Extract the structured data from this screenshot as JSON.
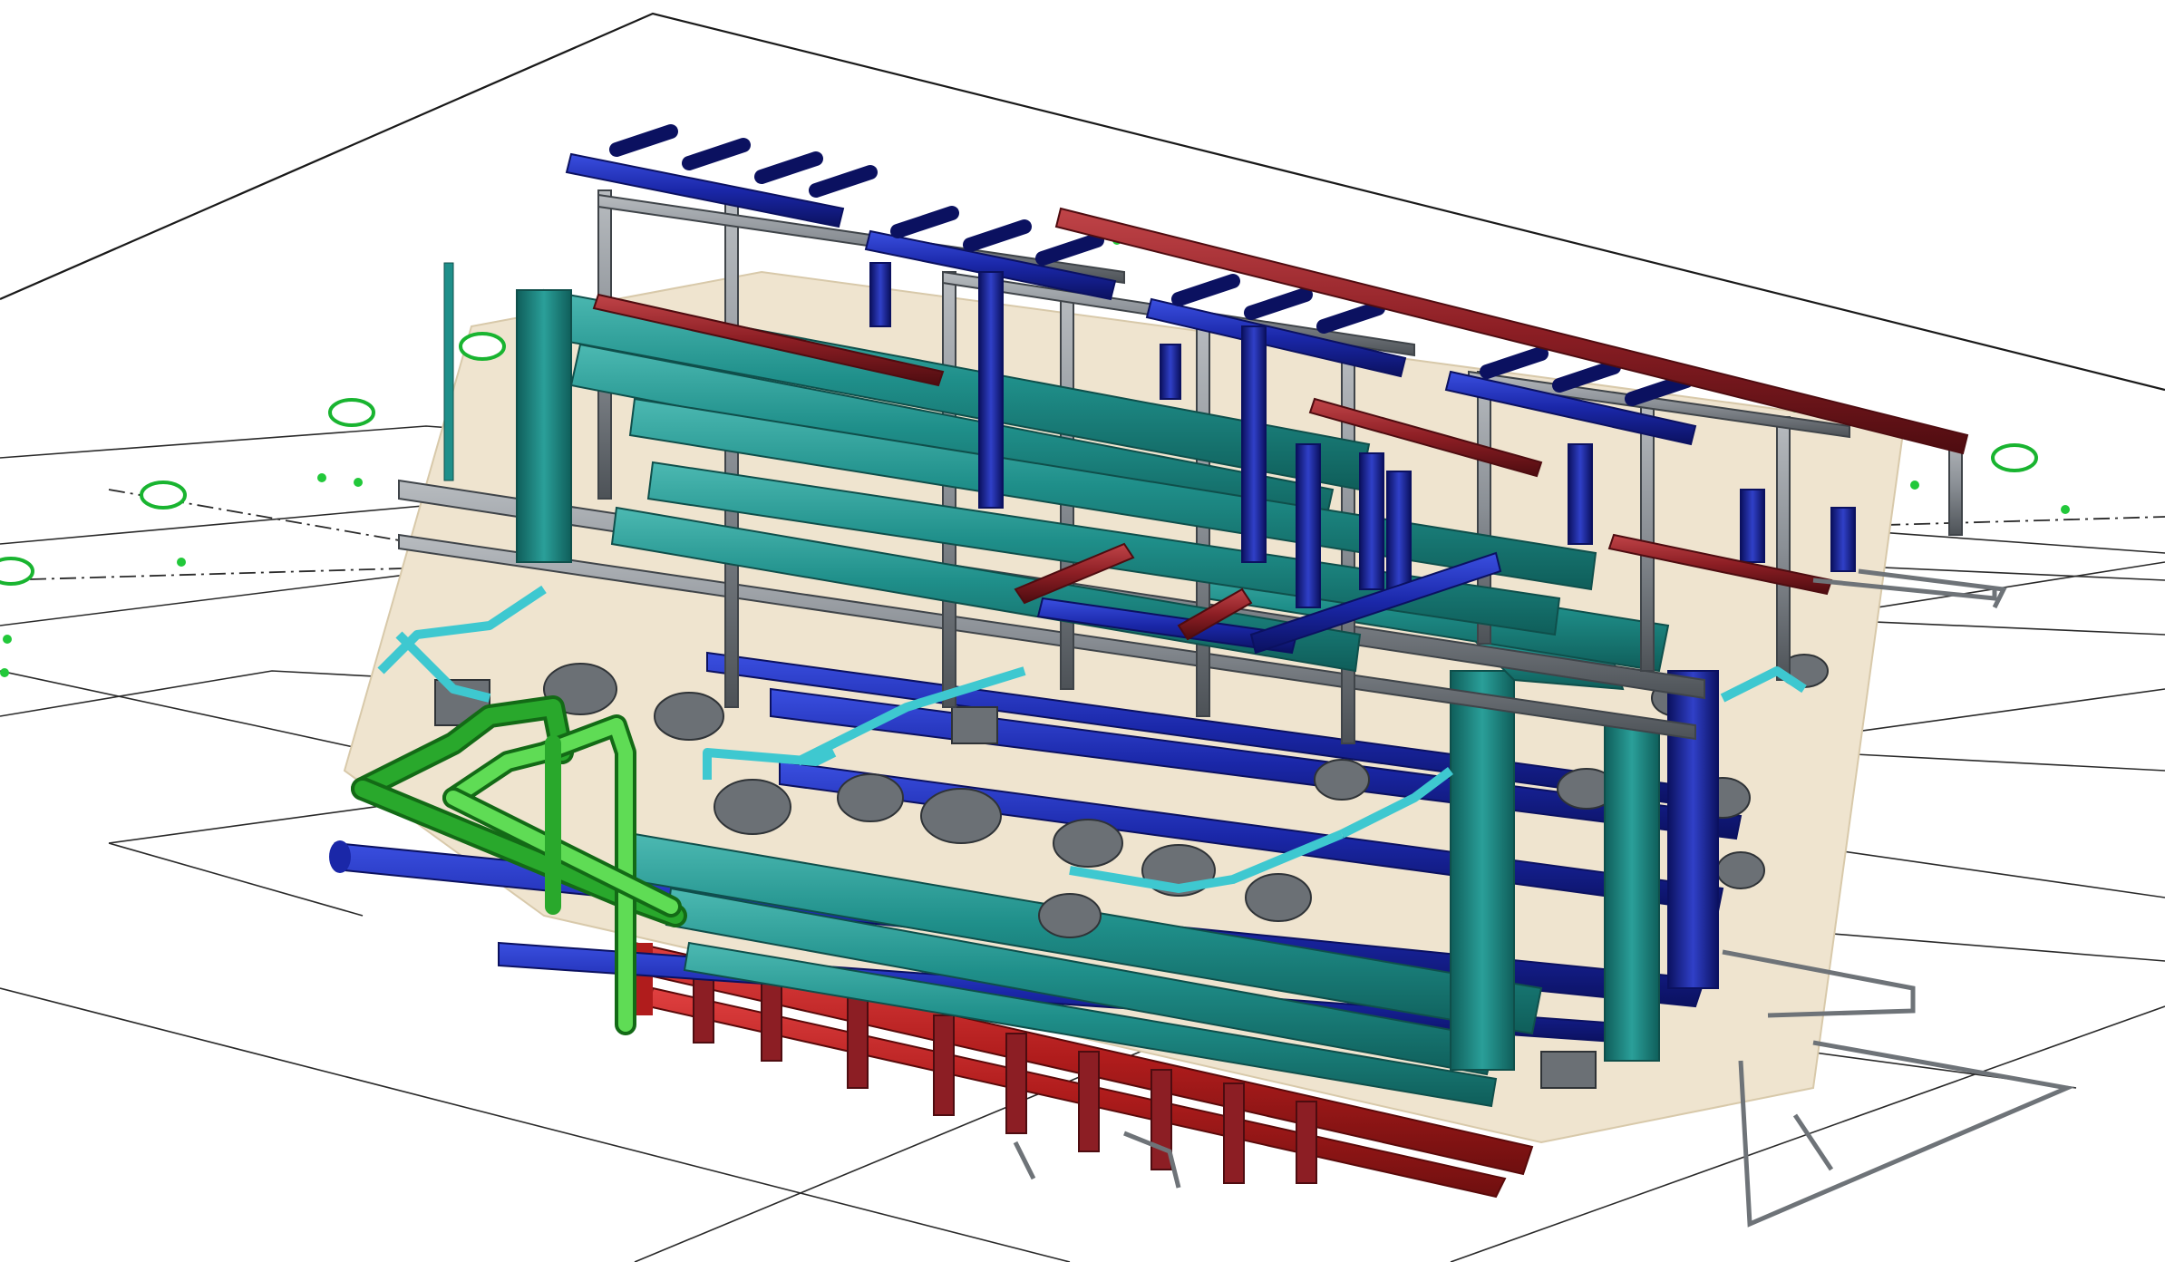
{
  "colors": {
    "background": "#ffffff",
    "grid_line": "#1a1a1a",
    "floor_slab": "#efe4cf",
    "teal_pipe": "#1f8f8a",
    "teal_pipe_light": "#4cb9b2",
    "teal_pipe_dark": "#0f5e5a",
    "blue_pipe": "#1a27a8",
    "blue_pipe_light": "#3a4fe0",
    "blue_pipe_dark": "#0b1160",
    "red_pipe": "#b01c1c",
    "red_pipe_dark": "#6e0f0f",
    "maroon_pipe": "#8c1e24",
    "green_pipe": "#29a82c",
    "green_pipe_light": "#5fdc55",
    "cyan_pipe": "#3ec8d0",
    "gray_support": "#8a8f95",
    "gray_support_dark": "#4d5257",
    "grid_marker_ring": "#19b430"
  },
  "grid_markers": [
    {
      "label": ""
    },
    {
      "label": ""
    },
    {
      "label": ""
    },
    {
      "label": ""
    },
    {
      "label": ""
    }
  ],
  "icons": {
    "grid_marker": "grid-bubble-icon"
  }
}
